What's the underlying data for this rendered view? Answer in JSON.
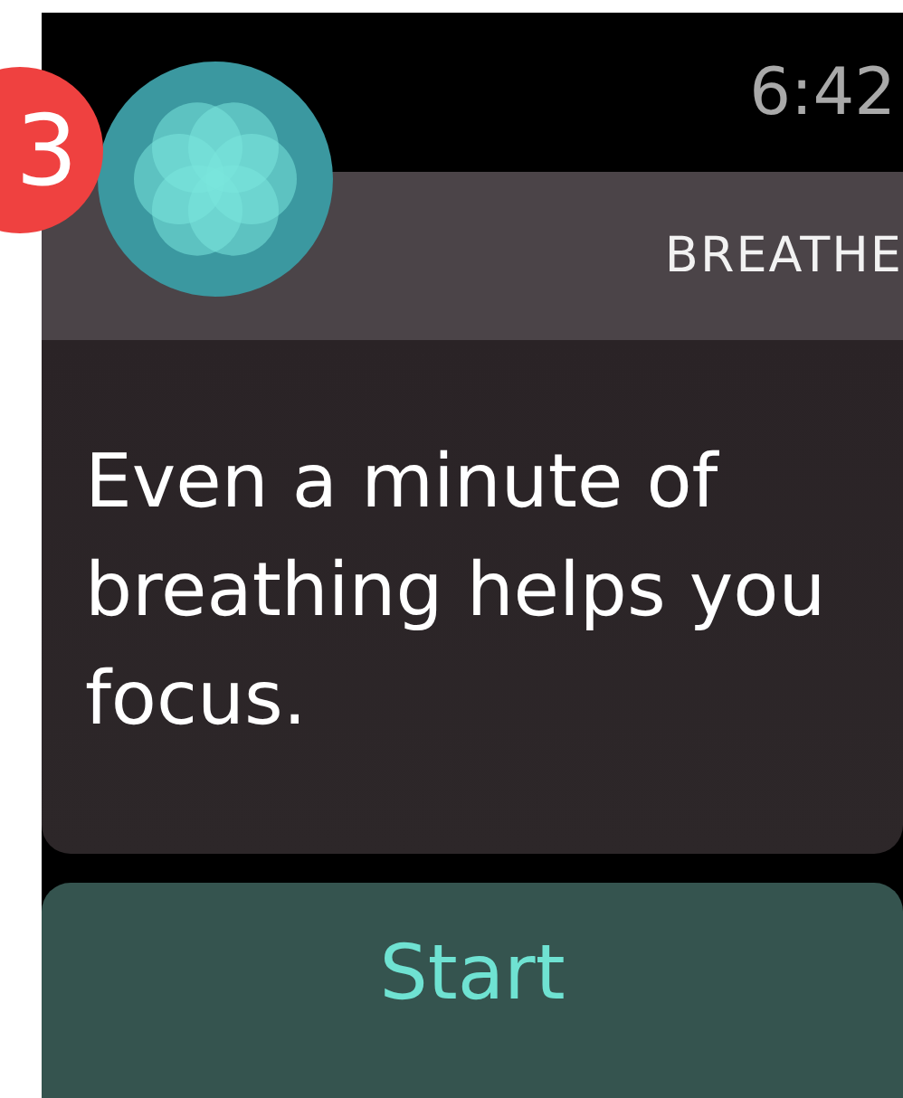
{
  "status_bar": {
    "time": "6:42"
  },
  "notification": {
    "badge_count": "3",
    "app_name": "BREATHE",
    "message": "Even a minute of breathing helps you focus."
  },
  "buttons": [
    {
      "label": "Start"
    }
  ]
}
